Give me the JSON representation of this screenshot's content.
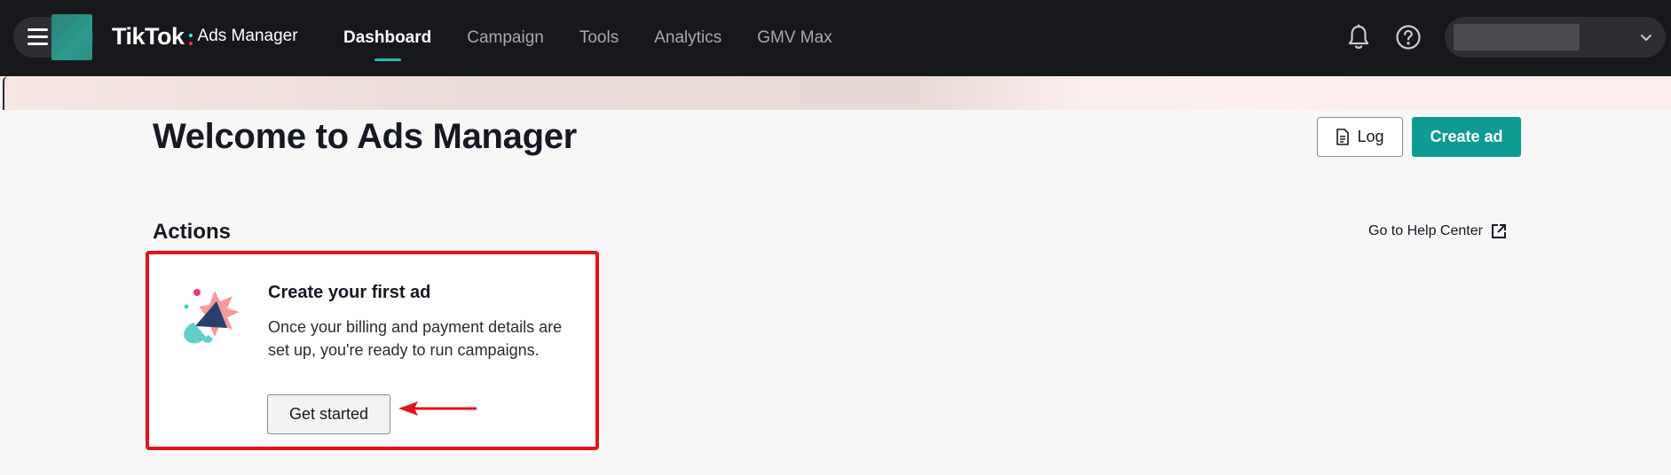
{
  "header": {
    "brand_name": "TikTok",
    "brand_product": "Ads Manager",
    "nav": [
      {
        "label": "Dashboard",
        "active": true
      },
      {
        "label": "Campaign",
        "active": false
      },
      {
        "label": "Tools",
        "active": false
      },
      {
        "label": "Analytics",
        "active": false
      },
      {
        "label": "GMV Max",
        "active": false
      }
    ],
    "icons": {
      "menu": "hamburger-icon",
      "notifications": "bell-icon",
      "help": "question-icon",
      "account_caret": "chevron-down-icon"
    }
  },
  "page": {
    "title": "Welcome to Ads Manager",
    "log_button": "Log",
    "create_button": "Create ad"
  },
  "actions": {
    "title": "Actions",
    "help_link": "Go to Help Center",
    "card": {
      "title": "Create your first ad",
      "description": "Once your billing and payment details are set up, you're ready to run campaigns.",
      "button": "Get started",
      "illustration": "megaphone-icon"
    }
  },
  "colors": {
    "topbar": "#17181c",
    "accent": "#0d9b94",
    "active_underline": "#2ab8b0",
    "highlight_border": "#e0141b",
    "annotation_arrow": "#e0141b"
  }
}
